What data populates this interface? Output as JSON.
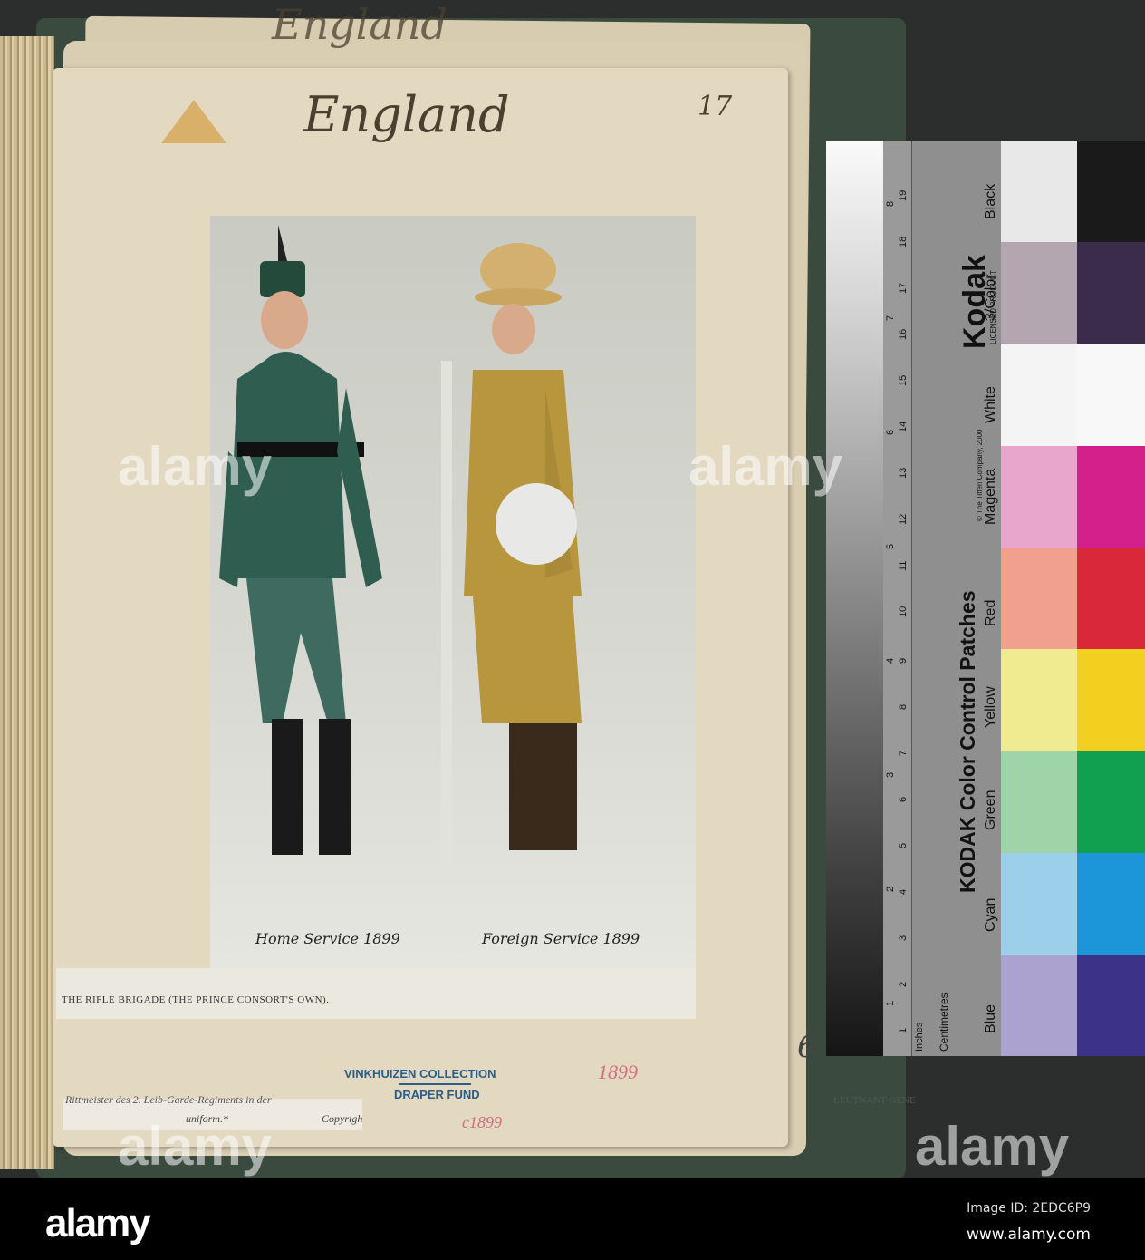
{
  "page": {
    "title_top": "England",
    "title_main": "England",
    "page_number": "17",
    "page_number_lower": "6"
  },
  "illustration": {
    "left_label": "Home Service 1899",
    "right_label": "Foreign Service 1899"
  },
  "caption": "THE RIFLE BRIGADE (THE PRINCE CONSORT'S OWN).",
  "stamp": {
    "collection": "VINKHUIZEN COLLECTION",
    "fund": "DRAPER FUND"
  },
  "annotations": {
    "red_year": "1899",
    "red_circa": "c1899"
  },
  "printed_fragments": {
    "line1": "Rittmeister des 2. Leib-Garde-Regiments in der",
    "line2": "uniform.*",
    "line3": "Copyrigh",
    "line4": "LEUTNANT-GENE"
  },
  "kodak": {
    "brand": "Kodak",
    "licensed": "LICENSED PRODUCT",
    "title": "KODAK Color Control Patches",
    "copyright": "© The Tiffen Company, 2000",
    "centimetres": "Centimetres",
    "inches": "Inches",
    "labels": [
      "Blue",
      "Cyan",
      "Green",
      "Yellow",
      "Red",
      "Magenta",
      "White",
      "3/Color",
      "Black"
    ],
    "patch_colors": [
      [
        "#e8e8e8",
        "#1a1a1a"
      ],
      [
        "#b4a6b0",
        "#3a2c4a"
      ],
      [
        "#f4f4f4",
        "#f8f8f8"
      ],
      [
        "#e8a6cc",
        "#d3208a"
      ],
      [
        "#f0a08c",
        "#d8283a"
      ],
      [
        "#f0ea90",
        "#f2d020"
      ],
      [
        "#9ed4a8",
        "#10a050"
      ],
      [
        "#9ccfea",
        "#1c96d8"
      ],
      [
        "#aca2d0",
        "#3c3288"
      ]
    ],
    "cm_ticks": [
      "1",
      "2",
      "3",
      "4",
      "5",
      "6",
      "7",
      "8",
      "9",
      "10",
      "11",
      "12",
      "13",
      "14",
      "15",
      "16",
      "17",
      "18",
      "19"
    ],
    "inch_ticks": [
      "1",
      "2",
      "3",
      "4",
      "5",
      "6",
      "7",
      "8"
    ]
  },
  "watermark": {
    "text": "alamy",
    "logo": "alamy",
    "image_id": "Image ID: 2EDC6P9",
    "site": "www.alamy.com"
  }
}
